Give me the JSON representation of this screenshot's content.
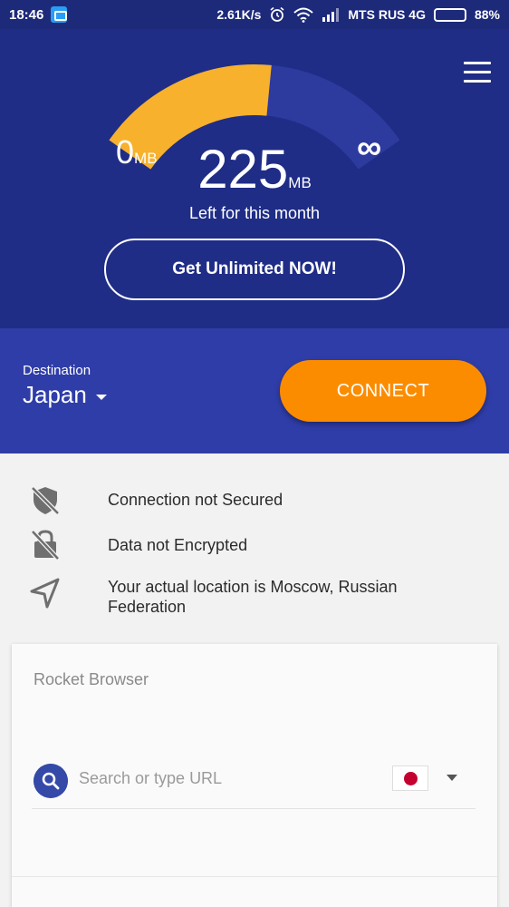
{
  "status_bar": {
    "time": "18:46",
    "speed": "2.61K/s",
    "carrier": "MTS RUS 4G",
    "battery": "88%",
    "battery_level": 0.88
  },
  "usage": {
    "min_value": "0",
    "min_unit": "MB",
    "remaining_value": "225",
    "remaining_unit": "MB",
    "remaining_label": "Left for this month",
    "max_symbol": "∞",
    "cta_label": "Get Unlimited NOW!",
    "gauge_fill_fraction": 0.55
  },
  "destination": {
    "label": "Destination",
    "value": "Japan",
    "connect_label": "CONNECT"
  },
  "status_items": [
    {
      "icon": "shield-off-icon",
      "text": "Connection not Secured"
    },
    {
      "icon": "lock-off-icon",
      "text": "Data not Encrypted"
    },
    {
      "icon": "location-arrow-icon",
      "text": "Your actual location is Moscow, Russian Federation"
    }
  ],
  "browser": {
    "title": "Rocket Browser",
    "search_placeholder": "Search or type URL",
    "flag_icon": "japan-flag-icon"
  },
  "colors": {
    "header_bg": "#1f2d86",
    "band_bg": "#2f3da8",
    "gauge_used": "#f7b12c",
    "gauge_remaining": "#2d3a9e",
    "accent": "#fb8c00"
  }
}
